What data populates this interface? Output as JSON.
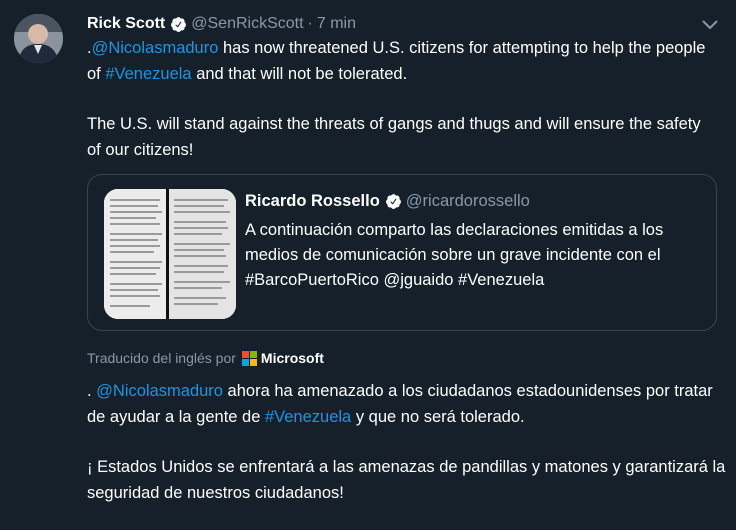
{
  "tweet": {
    "author_name": "Rick Scott",
    "handle": "@SenRickScott",
    "separator": "·",
    "time": "7 min",
    "paragraph1": {
      "prefix": ".",
      "mention": "@Nicolasmaduro",
      "mid": " has now threatened U.S. citizens for attempting to help the people of ",
      "hashtag": "#Venezuela",
      "suffix": " and that will not be tolerated."
    },
    "paragraph2": "The U.S. will stand against the threats of gangs and thugs and will ensure the safety of our citizens!"
  },
  "quoted_tweet": {
    "author_name": "Ricardo Rossello",
    "handle": "@ricardorossello",
    "text_line1": "A continuación comparto las declaraciones emitidas a los",
    "text_line2": "medios de comunicación sobre un grave incidente con el",
    "text_line3": "#BarcoPuertoRico @jguaido #Venezuela"
  },
  "translation": {
    "label": "Traducido del inglés por",
    "provider": "Microsoft",
    "paragraph1": {
      "prefix": ". ",
      "mention": "@Nicolasmaduro",
      "mid": " ahora ha amenazado a los ciudadanos estadounidenses por tratar de ayudar a la gente de ",
      "hashtag": "#Venezuela",
      "suffix": " y que no será tolerado."
    },
    "paragraph2": "¡ Estados Unidos se enfrentará a las amenazas de pandillas y matones y garantizará la seguridad de nuestros ciudadanos!"
  },
  "icons": {
    "verified": "verified-badge-icon",
    "caret": "chevron-down-icon",
    "microsoft": "microsoft-logo-icon"
  },
  "colors": {
    "background": "#15202b",
    "link": "#1b95e0",
    "muted": "#8899a6",
    "border": "#38444d"
  }
}
